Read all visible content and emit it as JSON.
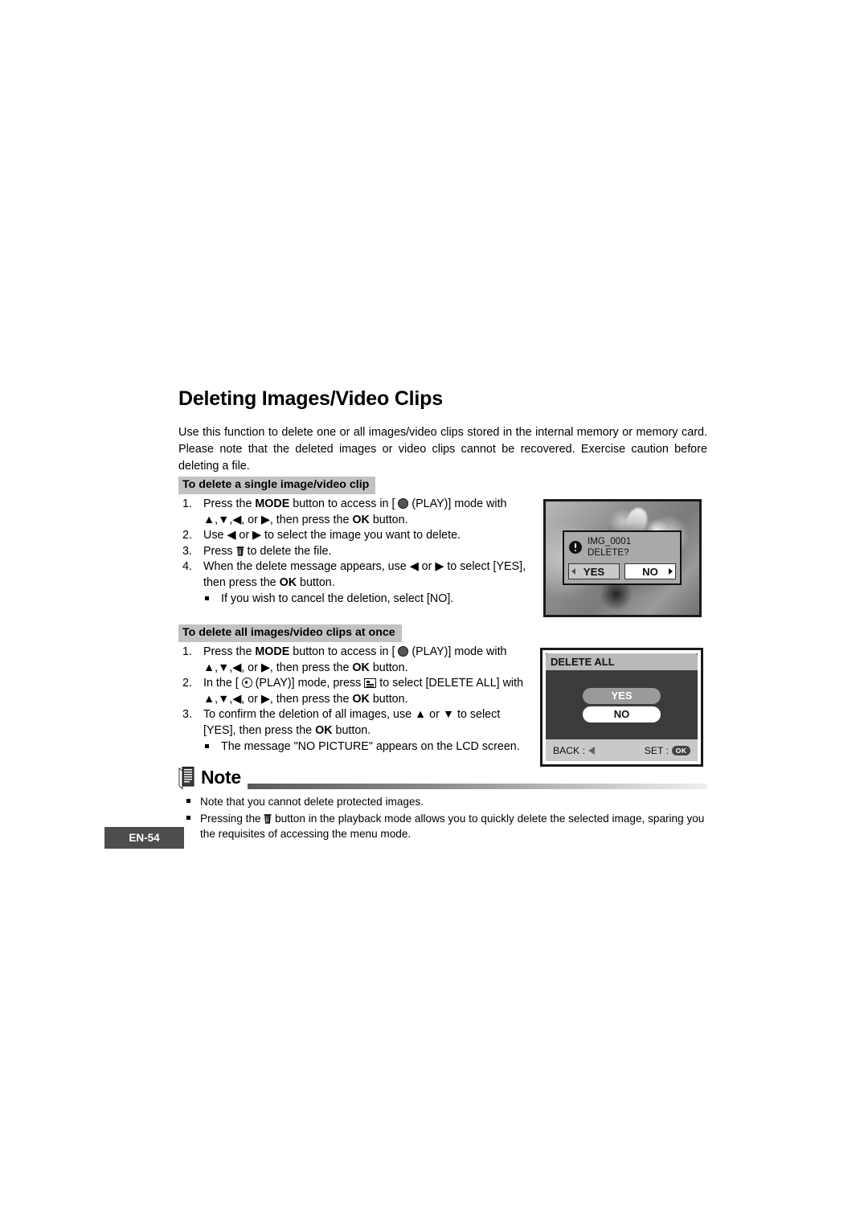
{
  "page": {
    "title": "Deleting Images/Video Clips",
    "intro": "Use this function to delete one or all images/video clips stored in the internal memory or memory card. Please note that the deleted images or video clips cannot be recovered. Exercise caution before deleting a file.",
    "page_number": "EN-54"
  },
  "section_single": {
    "header": "To delete a single image/video clip",
    "step1_a": "Press the ",
    "step1_mode": "MODE",
    "step1_b": " button to access in [ ",
    "step1_c": " (PLAY)] mode with ▲,▼,◀, or ▶, then press the ",
    "step1_ok": "OK",
    "step1_d": " button.",
    "step2": "Use ◀ or ▶ to select the image you want to delete.",
    "step3_a": "Press ",
    "step3_b": " to delete the file.",
    "step4_a": "When the delete message appears, use ◀ or ▶ to select [YES], then press the ",
    "step4_ok": "OK",
    "step4_b": " button.",
    "step4_sub": "If you wish to cancel the deletion, select [NO]."
  },
  "section_all": {
    "header": "To delete all images/video clips at once",
    "step1_a": "Press the ",
    "step1_mode": "MODE",
    "step1_b": " button to access in [ ",
    "step1_c": " (PLAY)] mode with ▲,▼,◀, or ▶, then press the ",
    "step1_ok": "OK",
    "step1_d": " button.",
    "step2_a": "In the [ ",
    "step2_b": " (PLAY)] mode, press ",
    "step2_c": " to select [DELETE ALL] with ▲,▼,◀, or ▶, then press the ",
    "step2_ok": "OK",
    "step2_d": " button.",
    "step3_a": "To confirm the deletion of all images, use ▲ or ▼ to select [YES], then press the ",
    "step3_ok": "OK",
    "step3_b": " button.",
    "step3_sub": "The message \"NO PICTURE\" appears on the LCD screen."
  },
  "lcd_delete_confirm": {
    "filename": "IMG_0001",
    "prompt": "DELETE?",
    "yes_label": "YES",
    "no_label": "NO"
  },
  "lcd_delete_all": {
    "title": "DELETE ALL",
    "option_yes": "YES",
    "option_no": "NO",
    "back_label": "BACK :",
    "set_label": "SET :",
    "ok_badge": "OK"
  },
  "note": {
    "heading": "Note",
    "item1": "Note that you cannot delete protected images.",
    "item2_a": "Pressing the ",
    "item2_b": " button in the playback mode allows you to quickly delete the selected image, sparing you the requisites of accessing the menu mode."
  },
  "colors": {
    "section_bar": "#c2c2c2",
    "page_tab": "#4d4d4d",
    "lcd_border": "#1a1a1a",
    "lcd_panel": "#3b3b3b",
    "selected_option": "#9a9a9a"
  }
}
